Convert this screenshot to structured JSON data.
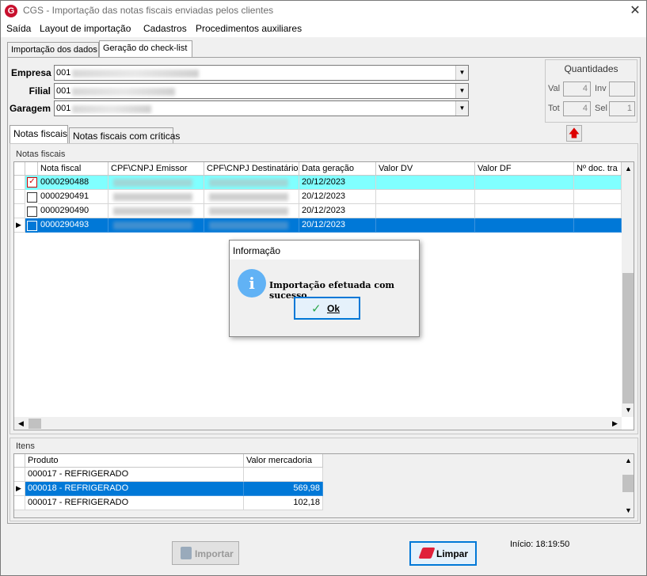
{
  "window": {
    "title": "CGS - Importação das notas fiscais enviadas pelos clientes"
  },
  "menu": [
    "Saída",
    "Layout de importação",
    "Cadastros",
    "Procedimentos auxiliares"
  ],
  "main_tabs": [
    "Importação dos dados",
    "Geração do check-list"
  ],
  "form": {
    "empresa_label": "Empresa",
    "empresa_value": "001",
    "filial_label": "Filial",
    "filial_value": "001",
    "garagem_label": "Garagem",
    "garagem_value": "001"
  },
  "quantidades": {
    "title": "Quantidades",
    "val_label": "Val",
    "val": "4",
    "inv_label": "Inv",
    "inv": "",
    "tot_label": "Tot",
    "tot": "4",
    "sel_label": "Sel",
    "sel": "1"
  },
  "sub_tabs": [
    "Notas fiscais",
    "Notas fiscais com críticas"
  ],
  "notas": {
    "group_title": "Notas fiscais",
    "columns": [
      "Nota fiscal",
      "CPF\\CNPJ Emissor",
      "CPF\\CNPJ Destinatário",
      "Data geração",
      "Valor DV",
      "Valor DF",
      "Nº doc. tra"
    ],
    "rows": [
      {
        "nota": "0000290488",
        "data": "20/12/2023",
        "checked": true
      },
      {
        "nota": "0000290491",
        "data": "20/12/2023",
        "checked": false
      },
      {
        "nota": "0000290490",
        "data": "20/12/2023",
        "checked": false
      },
      {
        "nota": "0000290493",
        "data": "20/12/2023",
        "checked": false
      }
    ]
  },
  "itens": {
    "group_title": "Itens",
    "columns": [
      "Produto",
      "Valor mercadoria"
    ],
    "rows": [
      {
        "produto": "000017 - REFRIGERADO",
        "valor": ""
      },
      {
        "produto": "000018 - REFRIGERADO",
        "valor": "569,98"
      },
      {
        "produto": "000017 - REFRIGERADO",
        "valor": "102,18"
      }
    ]
  },
  "buttons": {
    "importar": "Importar",
    "limpar": "Limpar"
  },
  "status": {
    "inicio": "Início: 18:19:50"
  },
  "dialog": {
    "title": "Informação",
    "message": "Importação efetuada com sucesso.",
    "ok": "Ok"
  },
  "colors": {
    "highlight_cyan": "#80ffff",
    "selection_blue": "#0078d7"
  }
}
